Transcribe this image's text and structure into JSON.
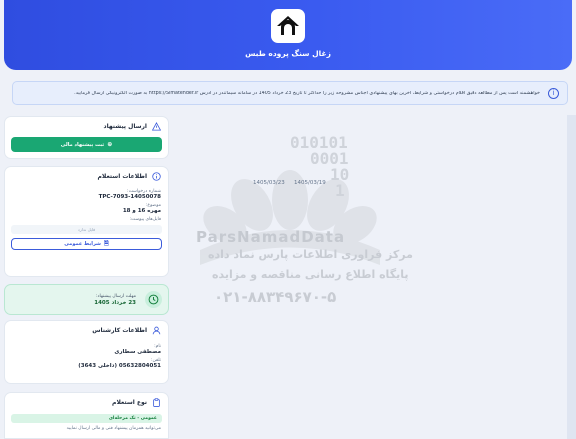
{
  "header": {
    "title": "زغال سنگ پروده طبس"
  },
  "notice": {
    "text": "خواهشمند است پس از مطالعه دقیق اقلام درخواستی و شرایط، آخرین بهای پیشنهادی اجناس مشروحه زیر را حداکثر تا تاریخ 23 خرداد 1405 در سامانه سیماتندر در آدرس https://Simatender.ir به صورت الکترونیکی ارسال فرمایید."
  },
  "offer_card": {
    "title": "ارسال پیشنهاد",
    "submit_label": "ثبت پیشنهاد مالی"
  },
  "inquiry_card": {
    "title": "اطلاعات استعلام",
    "request_no_label": "شماره درخواست:",
    "request_no_value": "TPC-7093-14050078",
    "subject_label": "موضوع:",
    "subject_value": "مهره 16 و 18",
    "attachments_label": "فایل‌های پیوست:",
    "no_file_text": "فایل ندارد",
    "conditions_label": "شرایط عمومی"
  },
  "deadline": {
    "label": "مهلت ارسال پیشنهاد:",
    "value": "23 خرداد 1405"
  },
  "expert_card": {
    "title": "اطلاعات کارشناس",
    "name_label": "نام:",
    "name_value": "مصطفی سطاری",
    "phone_label": "تلفن:",
    "phone_value": "05632804051 (داخلی 3643)"
  },
  "type_card": {
    "title": "نوع استعلام",
    "type_value": "عمومی - تک مرحله‌ای",
    "note": "می‌توانید همزمان پیشنهاد فنی و مالی ارسال نمایید"
  },
  "watermark": {
    "date_left": "1405/03/23",
    "date_right": "1405/03/19",
    "brand": "ParsNamadData",
    "line1": "مرکز فراوری اطلاعات پارس نماد داده",
    "line2": "پایگاه اطلاع رسانی مناقصه و مزایده",
    "phone": "۰۲۱-۸۸۳۴۹۶۷۰-۵"
  },
  "colors": {
    "hero": "#3a5bf0",
    "accent_green": "#1aa773",
    "primary_blue": "#3b5bdb"
  }
}
